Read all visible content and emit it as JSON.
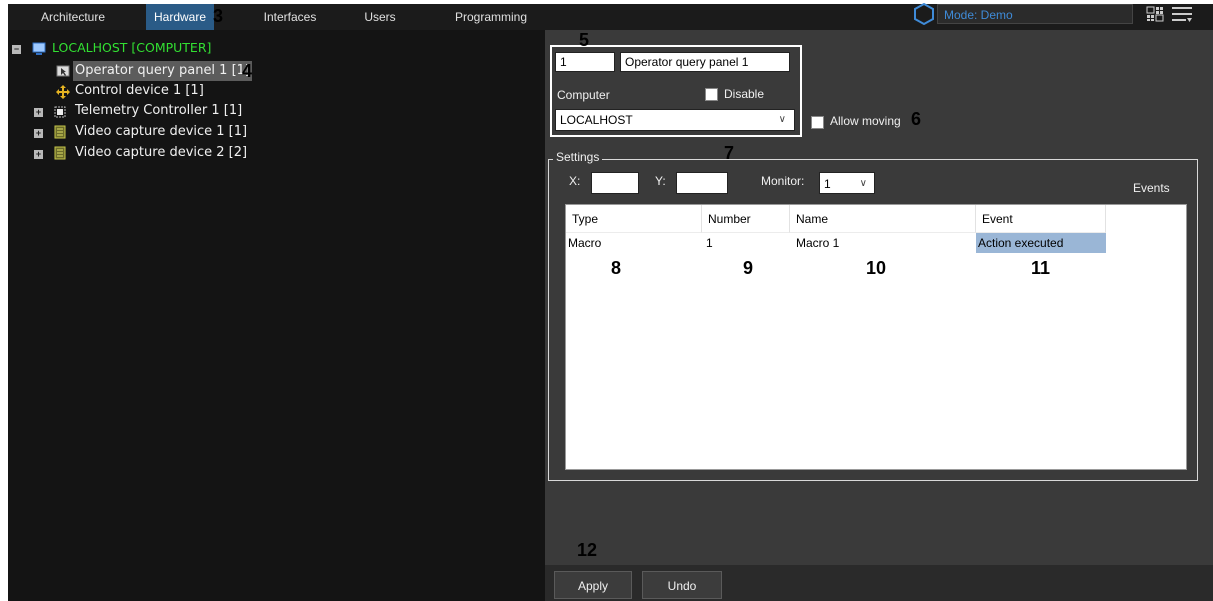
{
  "top_bar": {
    "tabs": [
      {
        "label": "Architecture"
      },
      {
        "label": "Hardware"
      },
      {
        "label": "Interfaces"
      },
      {
        "label": "Users"
      },
      {
        "label": "Programming"
      }
    ],
    "active_tab": "Hardware",
    "mode_text": "Mode: Demo",
    "mode_color": "#3f8bd8",
    "active_tab_color": "#2a5b87"
  },
  "tree": {
    "root_label": "LOCALHOST [COMPUTER]",
    "root_color": "#32e032",
    "items": [
      {
        "label": "Operator query panel 1 [1]",
        "icon": "query-panel-icon",
        "selected": true
      },
      {
        "label": "Control device 1 [1]",
        "icon": "move-icon"
      },
      {
        "label": "Telemetry Controller 1 [1]",
        "icon": "telemetry-icon"
      },
      {
        "label": "Video capture device 1 [1]",
        "icon": "capture-device-icon"
      },
      {
        "label": "Video capture device 2 [2]",
        "icon": "capture-device-icon"
      }
    ]
  },
  "panel": {
    "id_value": "1",
    "name_value": "Operator query panel 1",
    "computer_label": "Computer",
    "disable_label": "Disable",
    "computer_value": "LOCALHOST",
    "allow_moving_label": "Allow moving",
    "settings_legend": "Settings",
    "x_label": "X:",
    "y_label": "Y:",
    "monitor_label": "Monitor:",
    "monitor_value": "1",
    "events_label": "Events",
    "table": {
      "headers": [
        "Type",
        "Number",
        "Name",
        "Event"
      ],
      "rows": [
        [
          "Macro",
          "1",
          "Macro 1",
          "Action executed"
        ]
      ],
      "selected_cell_color": "#9ab6d6"
    },
    "apply_label": "Apply",
    "undo_label": "Undo"
  },
  "callouts": {
    "c3": "3",
    "c4": "4",
    "c5": "5",
    "c6": "6",
    "c7": "7",
    "c8": "8",
    "c9": "9",
    "c10": "10",
    "c11": "11",
    "c12": "12"
  }
}
